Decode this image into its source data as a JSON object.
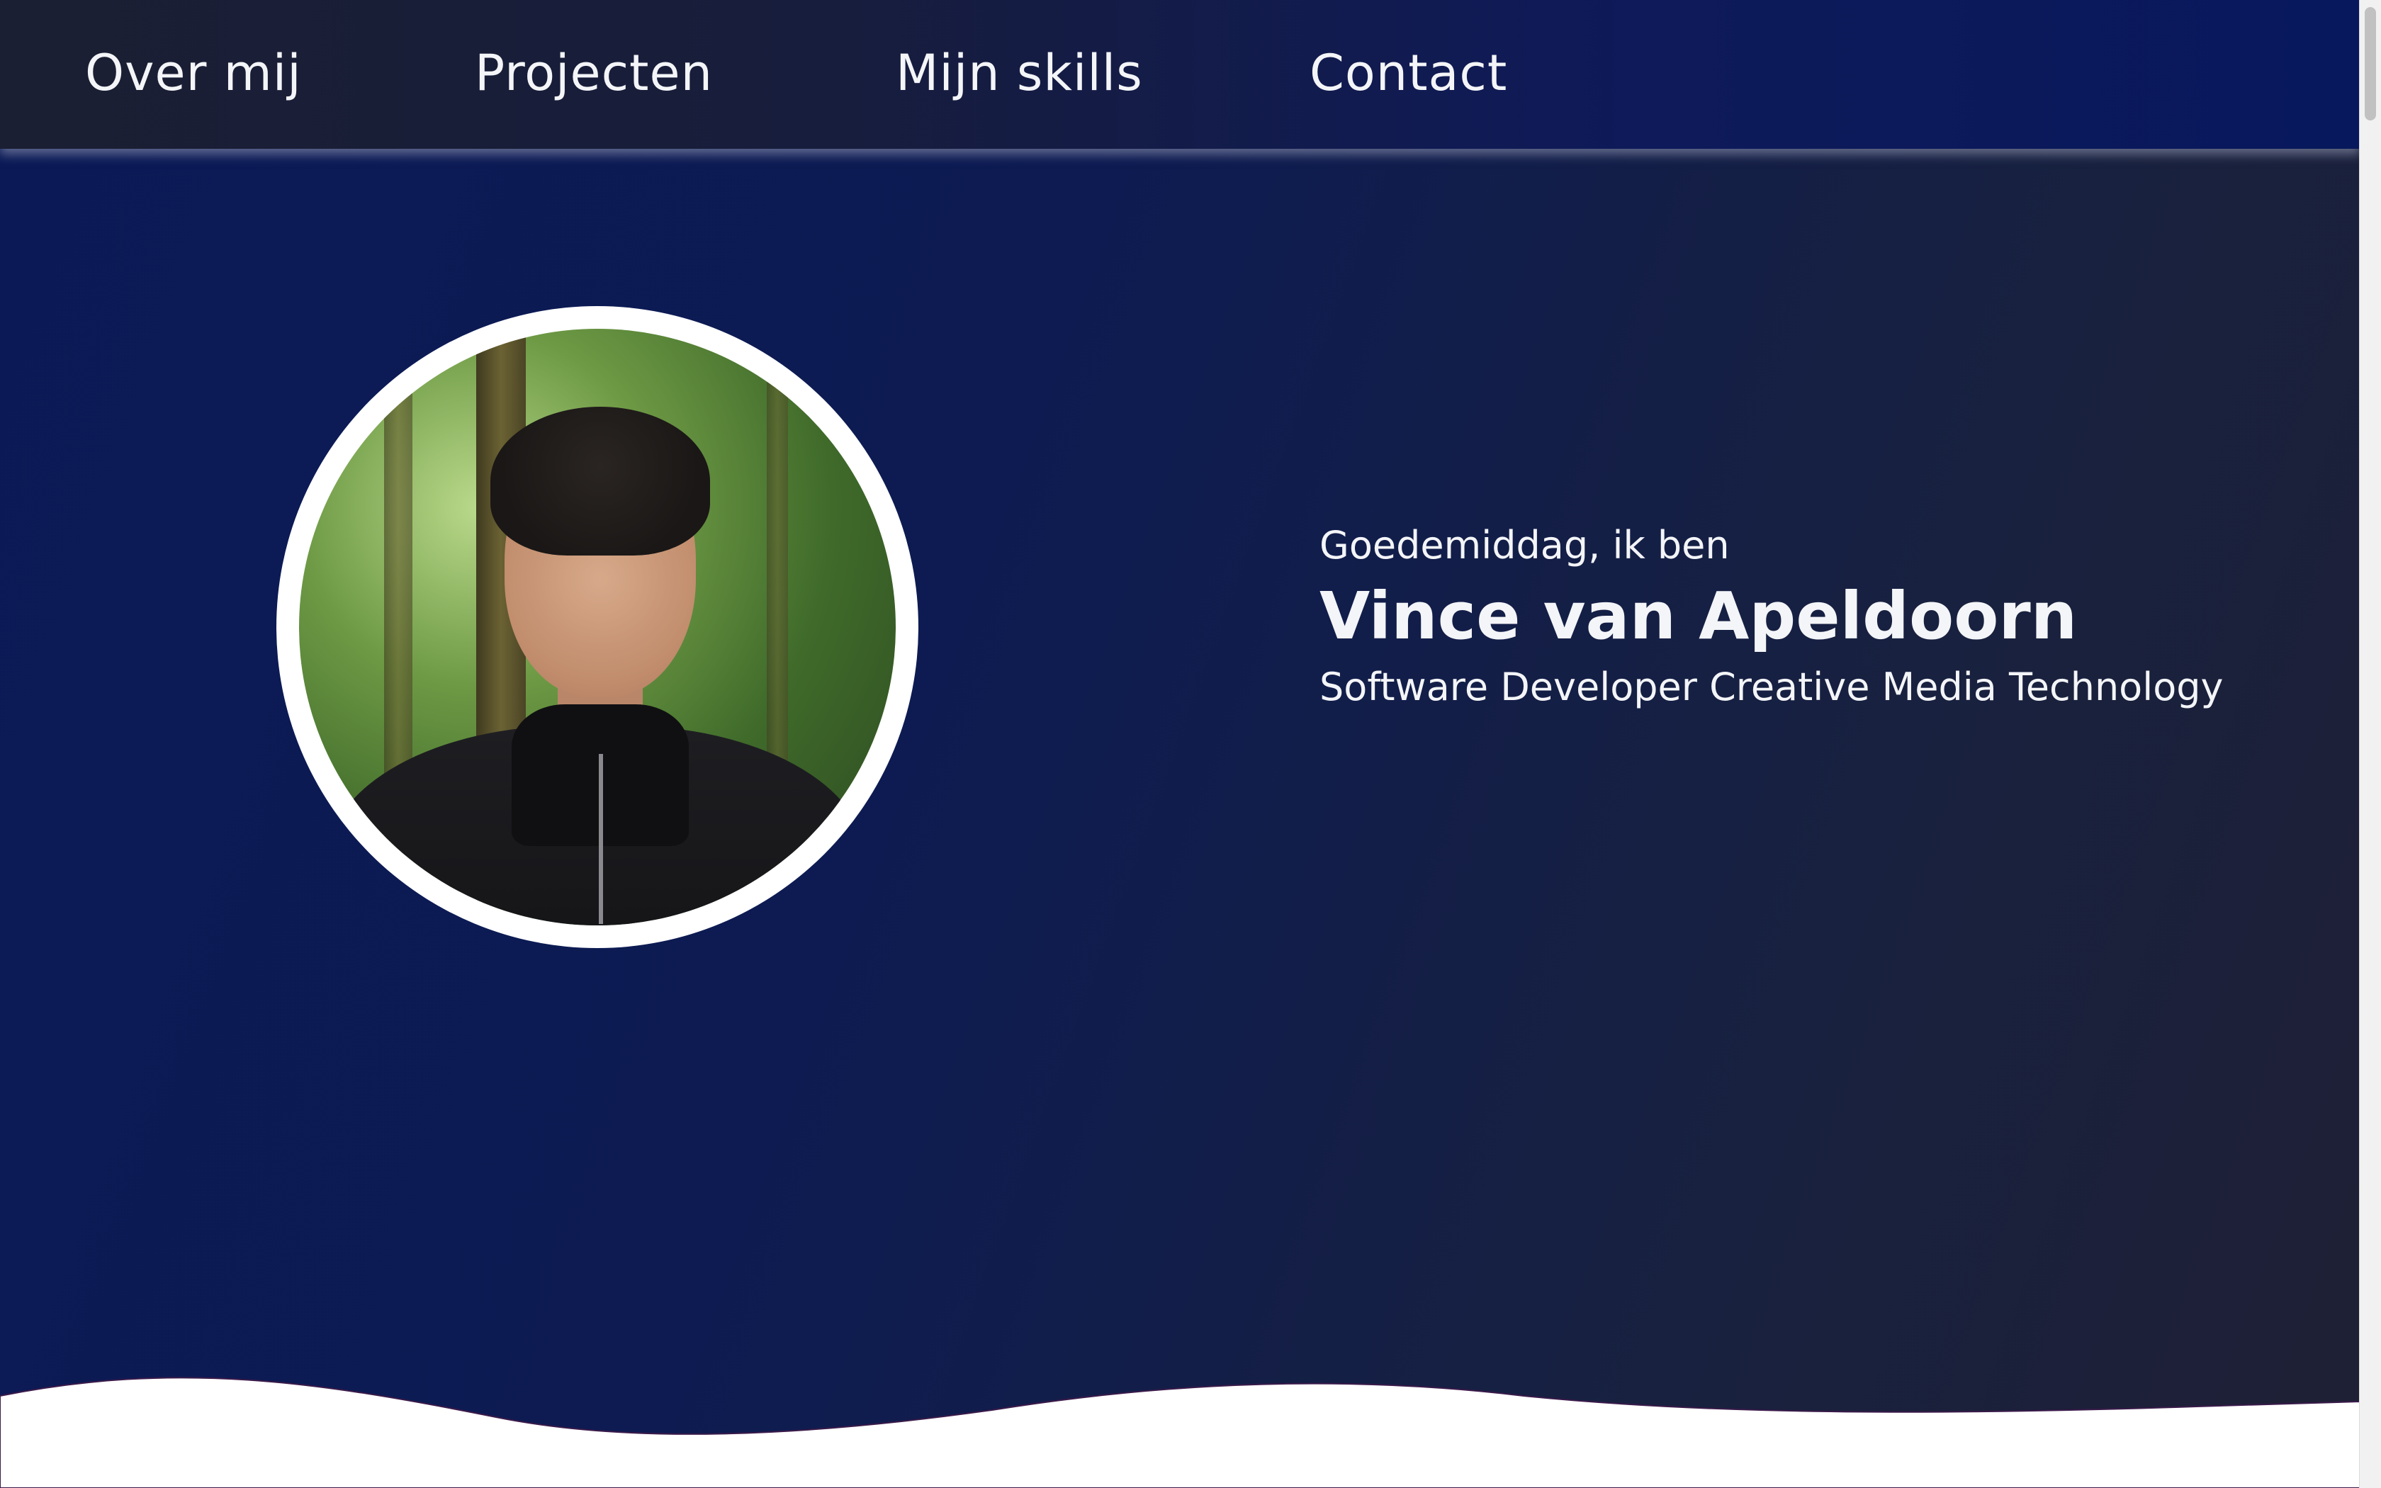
{
  "nav": {
    "items": [
      {
        "label": "Over mij"
      },
      {
        "label": "Projecten"
      },
      {
        "label": "Mijn skills"
      },
      {
        "label": "Contact"
      }
    ]
  },
  "hero": {
    "greeting": "Goedemiddag, ik ben",
    "name": "Vince van Apeldoorn",
    "role": "Software Developer Creative Media Technology"
  },
  "colors": {
    "nav_bg": "#0e1a5a",
    "hero_bg": "#0d1b52",
    "text": "#f4f5f8",
    "wave": "#ffffff"
  },
  "icons": {
    "photo": "profile-photo"
  }
}
